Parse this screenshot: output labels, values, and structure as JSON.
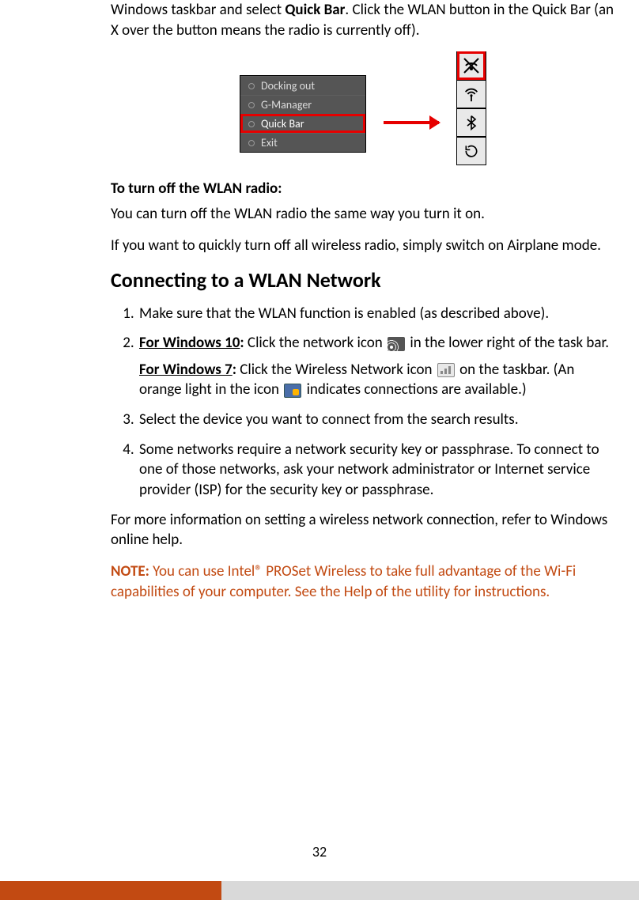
{
  "intro": {
    "line1_pre": "Windows taskbar and select ",
    "line1_bold": "Quick Bar",
    "line1_post": ". Click the WLAN button in the Quick Bar (an X over the button means the radio is currently off)."
  },
  "menu": {
    "items": [
      "Docking out",
      "G-Manager",
      "Quick Bar",
      "Exit"
    ],
    "selected_index": 2
  },
  "toolbar": {
    "icons": [
      "wlan-x-icon",
      "antenna-icon",
      "bluetooth-icon",
      "rotate-icon"
    ],
    "selected_index": 0
  },
  "turn_off": {
    "heading": "To turn off the WLAN radio:",
    "p1": "You can turn off the WLAN radio the same way you turn it on.",
    "p2": "If you want to quickly turn off all wireless radio, simply switch on Airplane mode."
  },
  "connecting": {
    "heading": "Connecting to a WLAN Network",
    "steps": {
      "s1": "Make sure that the WLAN function is enabled (as described above).",
      "s2_w10_label": "For Windows 10",
      "s2_w10_colon": ":",
      "s2_w10_pre": " Click the network icon ",
      "s2_w10_post": " in the lower right of the task bar.",
      "s2_w7_label": "For Windows 7",
      "s2_w7_colon": ":",
      "s2_w7_pre": " Click the Wireless Network icon ",
      "s2_w7_mid": " on the taskbar. (An orange light in the icon ",
      "s2_w7_post": " indicates connections are available.)",
      "s3": "Select the device you want to connect from the search results.",
      "s4": "Some networks require a network security key or passphrase. To connect to one of those networks, ask your network administrator or Internet service provider (ISP) for the security key or passphrase."
    },
    "closing": "For more information on setting a wireless network connection, refer to Windows online help."
  },
  "note": {
    "label": "NOTE:",
    "text": " You can use Intel® PROSet Wireless to take full advantage of the Wi-Fi capabilities of your computer. See the Help of the utility for instructions."
  },
  "page_number": "32"
}
